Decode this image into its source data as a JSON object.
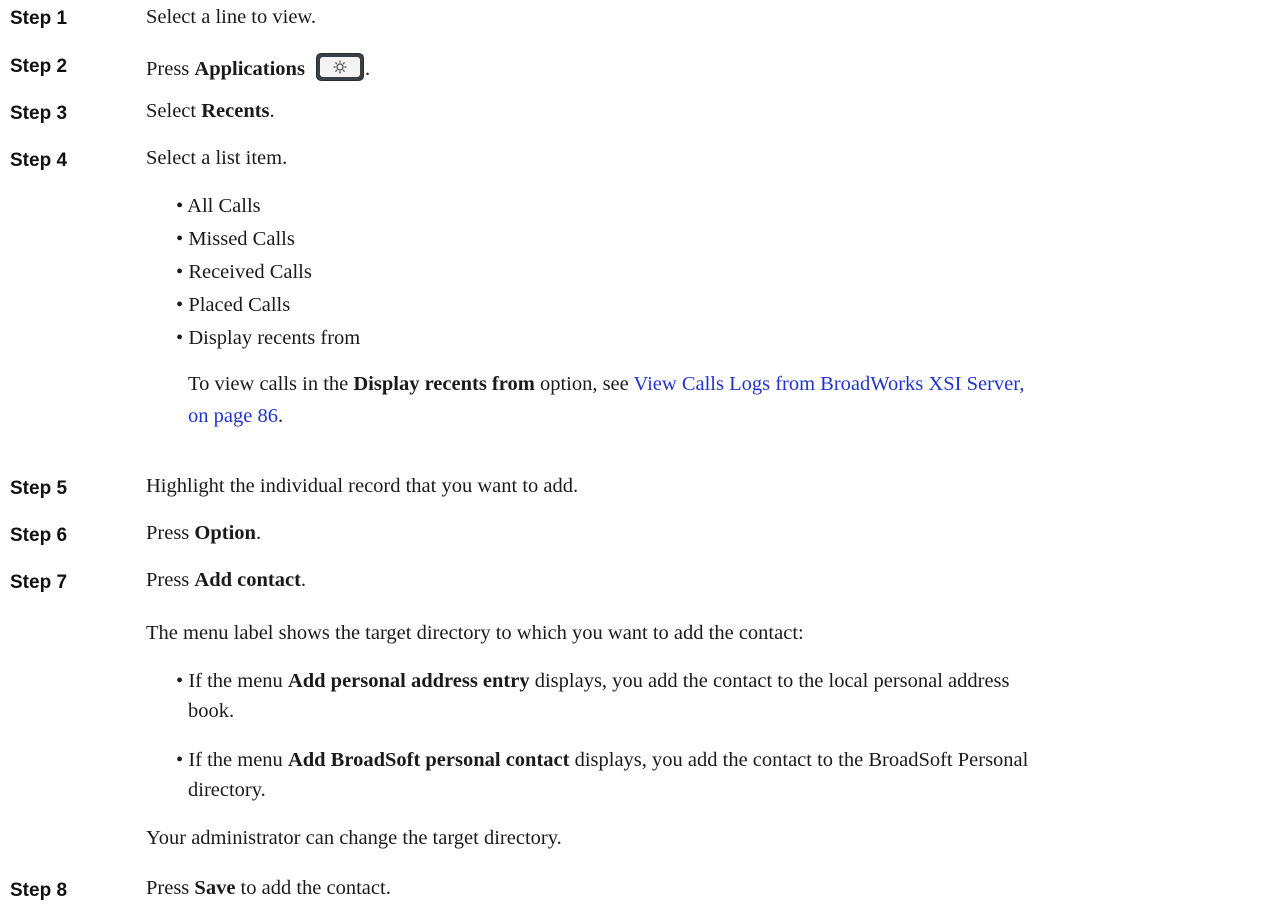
{
  "steps": {
    "s1": {
      "label": "Step 1",
      "text": "Select a line to view."
    },
    "s2": {
      "label": "Step 2",
      "pre": "Press ",
      "bold": "Applications",
      "post": ".",
      "icon": "gear-icon"
    },
    "s3": {
      "label": "Step 3",
      "pre": "Select ",
      "bold": "Recents",
      "post": "."
    },
    "s4": {
      "label": "Step 4",
      "text": "Select a list item.",
      "items": [
        "All Calls",
        "Missed Calls",
        "Received Calls",
        "Placed Calls",
        "Display recents from"
      ],
      "note_pre": "To view calls in the ",
      "note_bold": "Display recents from",
      "note_mid": " option, see ",
      "note_link_1": "View Calls Logs from BroadWorks XSI Server,",
      "note_link_2": "on page 86",
      "note_post": "."
    },
    "s5": {
      "label": "Step 5",
      "text": "Highlight the individual record that you want to add."
    },
    "s6": {
      "label": "Step 6",
      "pre": "Press ",
      "bold": "Option",
      "post": "."
    },
    "s7": {
      "label": "Step 7",
      "pre": "Press ",
      "bold": "Add contact",
      "post": ".",
      "para1": "The menu label shows the target directory to which you want to add the contact:",
      "b1_pre": "If the menu ",
      "b1_bold": "Add personal address entry",
      "b1_post": " displays, you add the contact to the local personal address",
      "b1_cont": "book.",
      "b2_pre": "If the menu ",
      "b2_bold": "Add BroadSoft personal contact",
      "b2_post": " displays, you add the contact to the BroadSoft Personal",
      "b2_cont": "directory.",
      "para2": "Your administrator can change the target directory."
    },
    "s8": {
      "label": "Step 8",
      "pre": "Press ",
      "bold": "Save",
      "post": " to add the contact."
    }
  },
  "colors": {
    "link": "#2233cc",
    "text": "#1a1a1a"
  }
}
